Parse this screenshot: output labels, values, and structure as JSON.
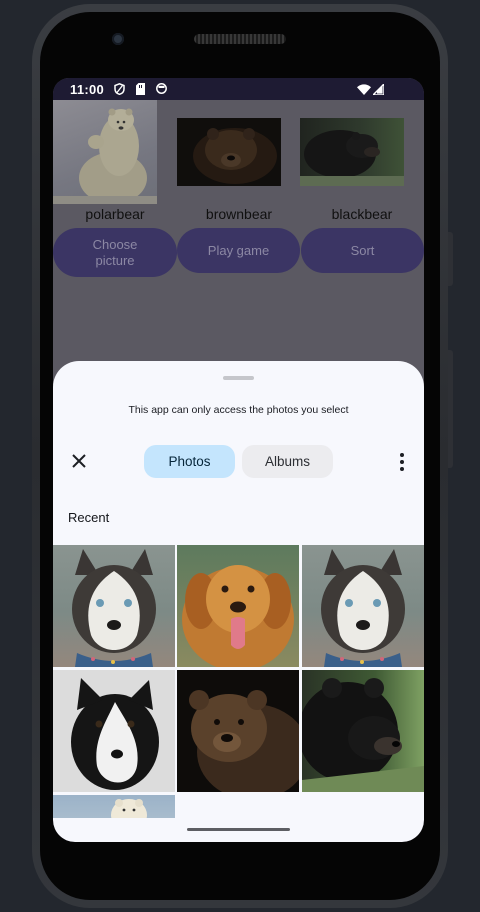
{
  "status_bar": {
    "time": "11:00",
    "left_icons": [
      "shield-icon",
      "sim-card-icon",
      "storage-icon"
    ],
    "right_icons": [
      "wifi-icon",
      "signal-icon"
    ]
  },
  "app": {
    "items": [
      {
        "caption": "polarbear",
        "image": "polar-bear-photo"
      },
      {
        "caption": "brownbear",
        "image": "brown-bear-photo"
      },
      {
        "caption": "blackbear",
        "image": "black-bear-photo"
      }
    ],
    "buttons": {
      "choose_line1": "Choose",
      "choose_line2": "picture",
      "play": "Play game",
      "sort": "Sort"
    }
  },
  "picker": {
    "notice": "This app can only access the photos you select",
    "tabs": {
      "photos": "Photos",
      "albums": "Albums"
    },
    "selected_tab": "Photos",
    "section_title": "Recent",
    "photos": [
      {
        "subject": "husky"
      },
      {
        "subject": "golden-retriever"
      },
      {
        "subject": "husky"
      },
      {
        "subject": "border-collie"
      },
      {
        "subject": "brown-bear"
      },
      {
        "subject": "black-bear"
      },
      {
        "subject": "polar-bear"
      }
    ]
  },
  "colors": {
    "status_bar": "#1e1b33",
    "app_background_dimmed": "#5b5962",
    "app_button": "#3b3564",
    "sheet_background": "#f7f8fd",
    "tab_selected": "#c4e5fd",
    "tab_unselected": "#ececef"
  }
}
